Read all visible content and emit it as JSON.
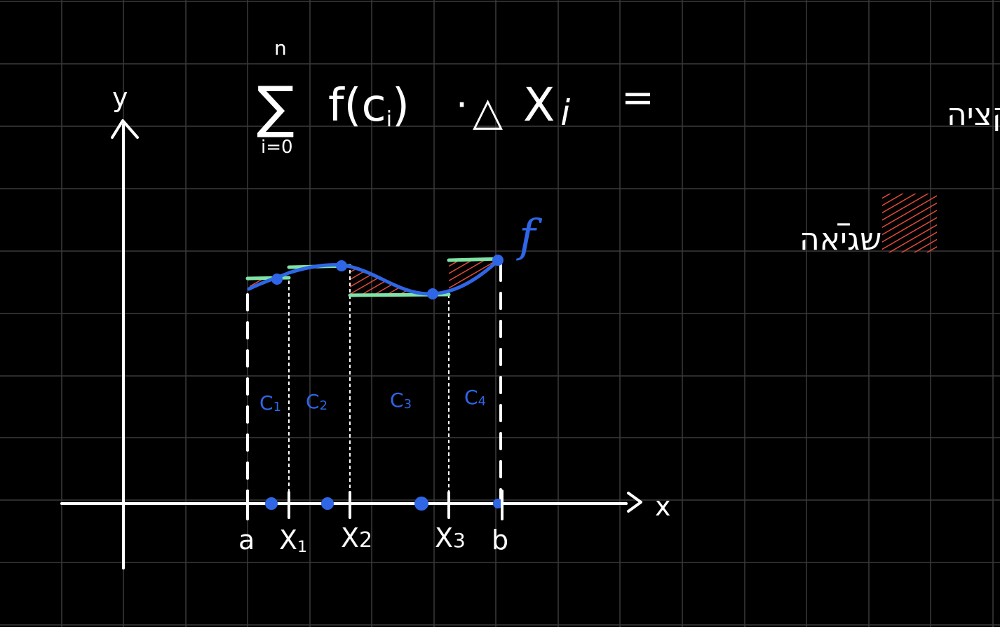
{
  "colors": {
    "background": "#000000",
    "grid": "#3a3a3a",
    "axis": "#ffffff",
    "curve": "#2f66e6",
    "rectangle_tops": "#7fe3a6",
    "error_hatch": "#e04a3a"
  },
  "formula": {
    "sum_upper": "n",
    "sum_symbol": "∑",
    "sum_lower": "i=0",
    "body": "f(c",
    "body_sub": "i",
    "body_close": ")",
    "dot": "·",
    "delta": "△",
    "x": "X",
    "x_sub": "i",
    "equals": "="
  },
  "labels": {
    "area_of_function": "שטח הפונקציה",
    "error_dash": "–",
    "error": "שגיאה",
    "function_name": "f",
    "y_axis": "y",
    "x_axis": "x",
    "a": "a",
    "b": "b"
  },
  "partition_ticks": [
    {
      "main": "X",
      "sub": "1"
    },
    {
      "main": "X",
      "sub": "2"
    },
    {
      "main": "X",
      "sub": "3"
    }
  ],
  "sample_points": [
    {
      "main": "C",
      "sub": "1"
    },
    {
      "main": "C",
      "sub": "2"
    },
    {
      "main": "C",
      "sub": "3"
    },
    {
      "main": "C",
      "sub": "4"
    }
  ]
}
